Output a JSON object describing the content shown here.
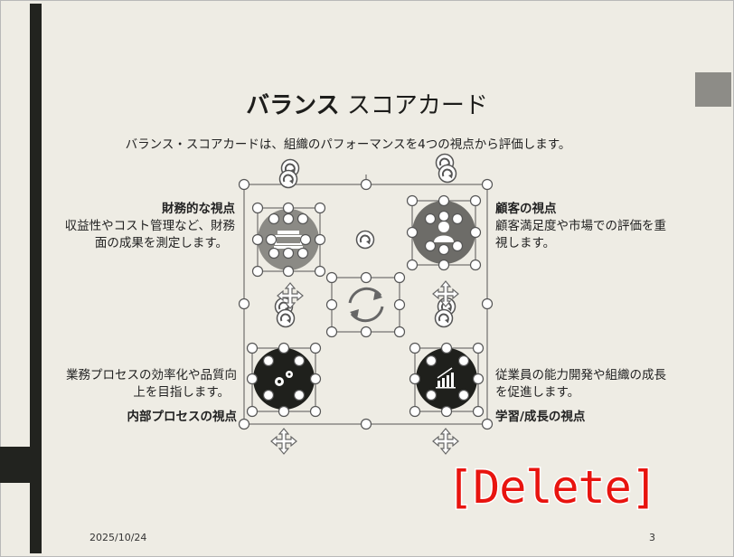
{
  "slide": {
    "title_bold": "バランス",
    "title_rest": " スコアカード",
    "subtitle": "バランス・スコアカードは、組織のパフォーマンスを4つの視点から評価します。",
    "quadrants": [
      {
        "id": "financial",
        "title": "財務的な視点",
        "desc1": "収益性やコスト管理など、財務",
        "desc2": "面の成果を測定します。",
        "icon": "money-icon"
      },
      {
        "id": "customer",
        "title": "顧客の視点",
        "desc1": "顧客満足度や市場での評価を重",
        "desc2": "視します。",
        "icon": "person-icon"
      },
      {
        "id": "process",
        "title": "内部プロセスの視点",
        "desc1": "業務プロセスの効率化や品質向",
        "desc2": "上を目指します。",
        "icon": "gears-icon"
      },
      {
        "id": "learning",
        "title": "学習/成長の視点",
        "desc1": "従業員の能力開発や組織の成長",
        "desc2": "を促進します。",
        "icon": "growth-chart-icon"
      }
    ],
    "date": "2025/10/24",
    "page_number": "3"
  },
  "overlay": {
    "keystroke": "[Delete]"
  },
  "colors": {
    "slide_bg": "#eeece4",
    "dark_bar": "#22231f",
    "financial_circle": "#8b8a85",
    "customer_circle": "#6d6c68",
    "dark_circle": "#1f201c",
    "keystroke": "#e8140f"
  }
}
